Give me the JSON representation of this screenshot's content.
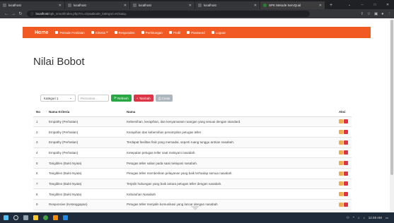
{
  "browser": {
    "tabs": [
      {
        "title": "localhost",
        "favicon": "page-icon",
        "active": false
      },
      {
        "title": "localhost",
        "favicon": "page-icon",
        "active": false
      },
      {
        "title": "localhost",
        "favicon": "page-icon",
        "active": false
      },
      {
        "title": "localhost",
        "favicon": "page-icon",
        "active": false
      },
      {
        "title": "SPK Metode ServQual",
        "favicon": "globe-icon",
        "active": true
      }
    ],
    "new_tab": "+",
    "url_host": "localhost",
    "url_path": "/spk_smu3/index.php?m=crips&kode_kategori=K01&q="
  },
  "navbar": {
    "home": "Home",
    "items": [
      {
        "label": "Periode Penilaian",
        "icon": "grid-icon"
      },
      {
        "label": "Kriteria",
        "icon": "grid-icon",
        "caret": "▾"
      },
      {
        "label": "Responden",
        "icon": "user-icon"
      },
      {
        "label": "Perhitungan",
        "icon": "grid-icon"
      },
      {
        "label": "Profil",
        "icon": "user-icon"
      },
      {
        "label": "Password",
        "icon": "lock-icon"
      },
      {
        "label": "Logout",
        "icon": "logout-icon"
      }
    ],
    "color": "#f15a22"
  },
  "page_title": "Nilai Bobot",
  "filters": {
    "kategori_value": "Kategori 1",
    "search_placeholder": "Pencarian...",
    "refresh_label": "Refresh",
    "tambah_label": "Tambah",
    "cetak_label": "Cetak"
  },
  "table": {
    "headers": {
      "no": "No",
      "kriteria": "Nama Kriteria",
      "nama": "Nama",
      "aksi": "Aksi"
    },
    "rows": [
      {
        "no": "1",
        "kriteria": "Empathy (Perhatian)",
        "nama": "Kebersihan, kerapihan, dan kenyamanan ruangan yang sesuai dengan standard."
      },
      {
        "no": "2",
        "kriteria": "Empathy (Perhatian)",
        "nama": "Kerapihan dan kebersihan penampilan petugas teller"
      },
      {
        "no": "3",
        "kriteria": "Empathy (Perhatian)",
        "nama": "Terdapat fasilitas fisik yang memadai, seperti ruang tunggu antrian nasabah."
      },
      {
        "no": "4",
        "kriteria": "Empathy (Perhatian)",
        "nama": "Ketepatan petugas teller saat melayani nasabah."
      },
      {
        "no": "5",
        "kriteria": "Tangibles (Bukti Nyata)",
        "nama": "Petugas teller sabar pada saat melayani nasabah."
      },
      {
        "no": "6",
        "kriteria": "Tangibles (Bukti Nyata)",
        "nama": "Petugas teller memberikan pelayanan yang baik terhadap semua nasabah."
      },
      {
        "no": "7",
        "kriteria": "Tangibles (Bukti Nyata)",
        "nama": "Terjalin hubungan yang baik antara petugas teller dengan nasabah."
      },
      {
        "no": "8",
        "kriteria": "Tangibles (Bukti Nyata)",
        "nama": "Kebutuhan Nasabah"
      },
      {
        "no": "9",
        "kriteria": "Responsive (Ketanggapan)",
        "nama": "Petugas teller menjalin komunikasi yang lancar dengan nasabah"
      },
      {
        "no": "10",
        "kriteria": "Responsive (Ketanggapan)",
        "nama": "Petugas teller memiliki pengetahuan yang cukup untuk menjawab pertanyaan nasabah."
      }
    ],
    "edit_color": "#f0ad4e",
    "delete_color": "#dc3545"
  },
  "taskbar": {
    "clock": "12:49 AM"
  }
}
